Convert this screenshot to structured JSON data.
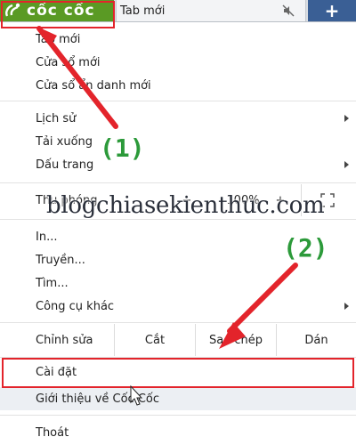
{
  "browser": {
    "brand_name": "cốc cốc",
    "active_tab_title": "Tab mới",
    "new_tab_symbol": "+"
  },
  "menu": {
    "new_tab": "Tab mới",
    "new_window": "Cửa sổ mới",
    "incognito_window": "Cửa sổ ẩn danh mới",
    "history": "Lịch sử",
    "downloads": "Tải xuống",
    "bookmarks": "Dấu trang",
    "zoom_label": "Thu phóng",
    "zoom_minus": "−",
    "zoom_value": "100%",
    "zoom_plus": "+",
    "print": "In...",
    "cast": "Truyền...",
    "find": "Tìm...",
    "more_tools": "Công cụ khác",
    "edit_label": "Chỉnh sửa",
    "cut": "Cắt",
    "copy": "Sao chép",
    "paste": "Dán",
    "settings": "Cài đặt",
    "about": "Giới thiệu về Cốc Cốc",
    "exit": "Thoát"
  },
  "annotations": {
    "step1": "(1)",
    "step2": "(2)",
    "watermark": "blogchiasekienthuc.com",
    "marker_color": "#e3242b",
    "label_color": "#2c9a3a"
  },
  "colors": {
    "brand_green": "#5a9a24",
    "new_tab_blue": "#3a5f95"
  }
}
